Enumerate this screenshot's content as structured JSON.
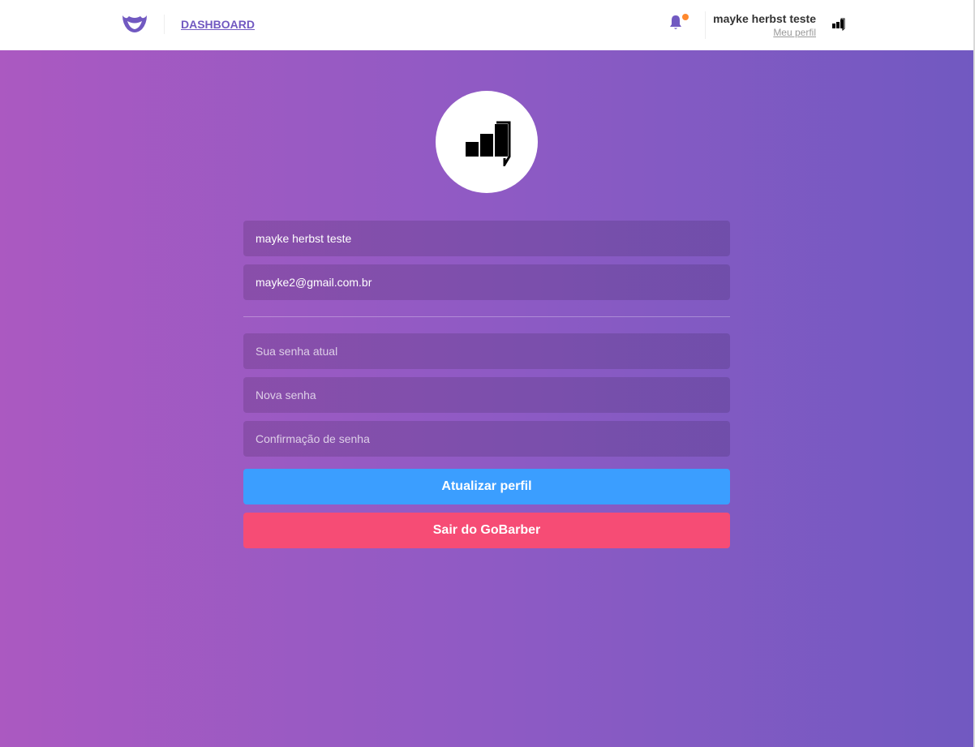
{
  "header": {
    "logo_icon": "mustache-logo-icon",
    "nav_link": "DASHBOARD",
    "notification_icon": "bell-icon",
    "has_unread_notifications": true,
    "user": {
      "name": "mayke herbst teste",
      "profile_link": "Meu perfil",
      "avatar_icon": "signal-bars-icon"
    }
  },
  "profile_form": {
    "avatar_icon": "signal-bars-icon",
    "name_value": "mayke herbst teste",
    "email_value": "mayke2@gmail.com.br",
    "old_password_placeholder": "Sua senha atual",
    "new_password_placeholder": "Nova senha",
    "confirm_password_placeholder": "Confirmação de senha",
    "update_button": "Atualizar perfil",
    "logout_button": "Sair do GoBarber"
  },
  "colors": {
    "brand": "#7159c1",
    "gradient_start": "#ab59c1",
    "gradient_end": "#7159c1",
    "update_button": "#3b9eff",
    "logout_button": "#f64c75",
    "notification_dot": "#ff892e"
  }
}
